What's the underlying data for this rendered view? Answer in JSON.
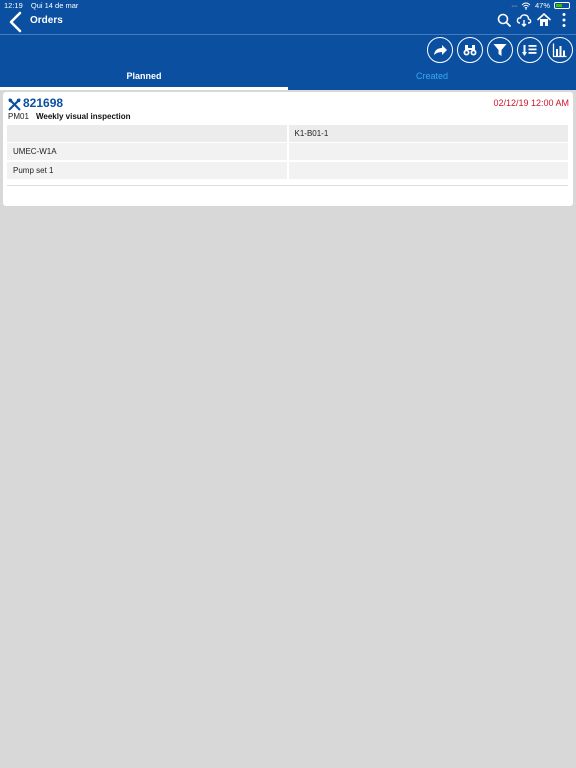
{
  "status_bar": {
    "time": "12:19",
    "date": "Qui 14 de mar",
    "battery": "47%"
  },
  "header": {
    "title": "Orders"
  },
  "header_icons": [
    "search-icon",
    "cloud-sync-icon",
    "home-icon",
    "more-vertical-icon"
  ],
  "toolbar_icons": [
    "forward-icon",
    "binoculars-icon",
    "filter-icon",
    "sort-icon",
    "chart-icon"
  ],
  "tabs": [
    {
      "label": "Planned"
    },
    {
      "label": "Created"
    }
  ],
  "order": {
    "number": "821698",
    "date": "02/12/19 12:00 AM",
    "type": "PM01",
    "description": "Weekly visual inspection",
    "rows": [
      {
        "left": "",
        "right": "K1-B01-1"
      },
      {
        "left": "UMEC-W1A",
        "right": ""
      },
      {
        "left": "Pump set 1",
        "right": ""
      }
    ]
  },
  "colors": {
    "header_bg": "#0a4fa0",
    "date_red": "#d0142c",
    "tab_inactive": "#3aa9ef"
  }
}
